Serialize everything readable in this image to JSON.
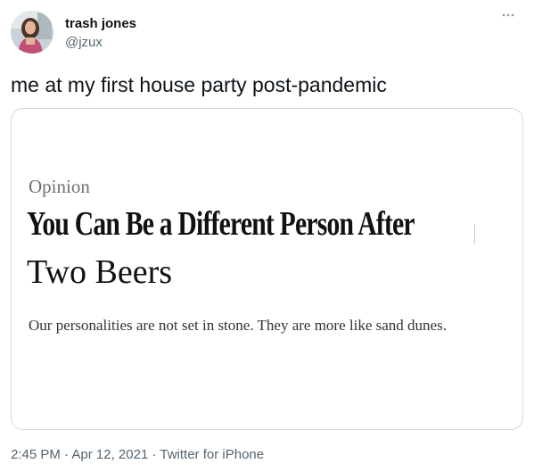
{
  "author": {
    "display_name": "trash jones",
    "handle": "@jzux",
    "avatar_icon": "profile-photo"
  },
  "more_icon": "ellipsis-icon",
  "tweet": {
    "text": "me at my first house party post-pandemic"
  },
  "card": {
    "kicker": "Opinion",
    "headline_line_1": "You Can Be a Different Person After",
    "headline_line_2": "Two Beers",
    "dek": "Our personalities are not set in stone. They are more like sand dunes."
  },
  "meta": {
    "time": "2:45 PM",
    "separator": "·",
    "date": "Apr 12, 2021",
    "source": "Twitter for iPhone"
  },
  "colors": {
    "text_primary": "#0f1419",
    "text_secondary": "#536471",
    "card_border": "#d3d8dc"
  }
}
